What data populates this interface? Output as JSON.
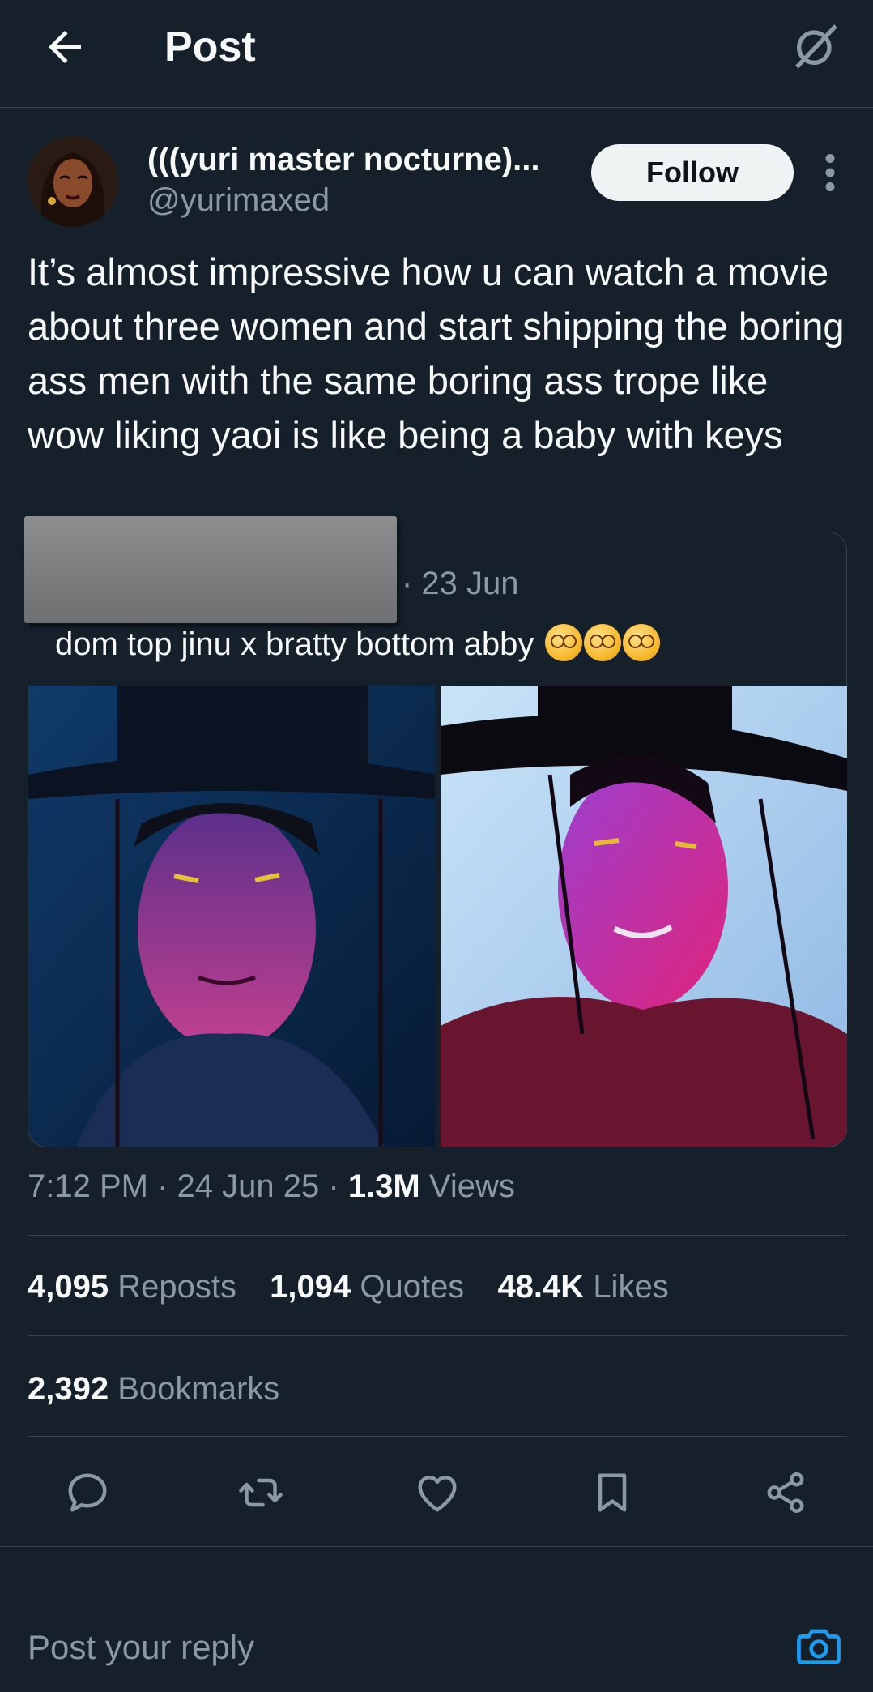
{
  "header": {
    "title": "Post",
    "back_icon": "arrow-left-icon",
    "grok_icon": "grok-icon"
  },
  "author": {
    "name": "(((yuri master nocturne)...",
    "handle": "@yurimaxed",
    "follow_label": "Follow"
  },
  "tweet": {
    "text": "It’s almost impressive how u can watch a movie about three women and start shipping the boring ass men with the same boring ass trope like wow liking yaoi is like being a baby with keys"
  },
  "quote": {
    "date": "· 23 Jun",
    "text": "dom top jinu x bratty bottom abby"
  },
  "meta": {
    "time": "7:12 PM",
    "date": "24 Jun 25",
    "views_count": "1.3M",
    "views_label": "Views",
    "sep": "·"
  },
  "stats": {
    "reposts_count": "4,095",
    "reposts_label": "Reposts",
    "quotes_count": "1,094",
    "quotes_label": "Quotes",
    "likes_count": "48.4K",
    "likes_label": "Likes",
    "bookmarks_count": "2,392",
    "bookmarks_label": "Bookmarks"
  },
  "actions": [
    "reply-icon",
    "repost-icon",
    "like-icon",
    "bookmark-icon",
    "share-icon"
  ],
  "reply": {
    "placeholder": "Post your reply"
  },
  "colors": {
    "background": "#15202b",
    "text": "#f7f9f9",
    "muted": "#8b98a5",
    "border": "#38444d",
    "accent": "#1d9bf0"
  }
}
